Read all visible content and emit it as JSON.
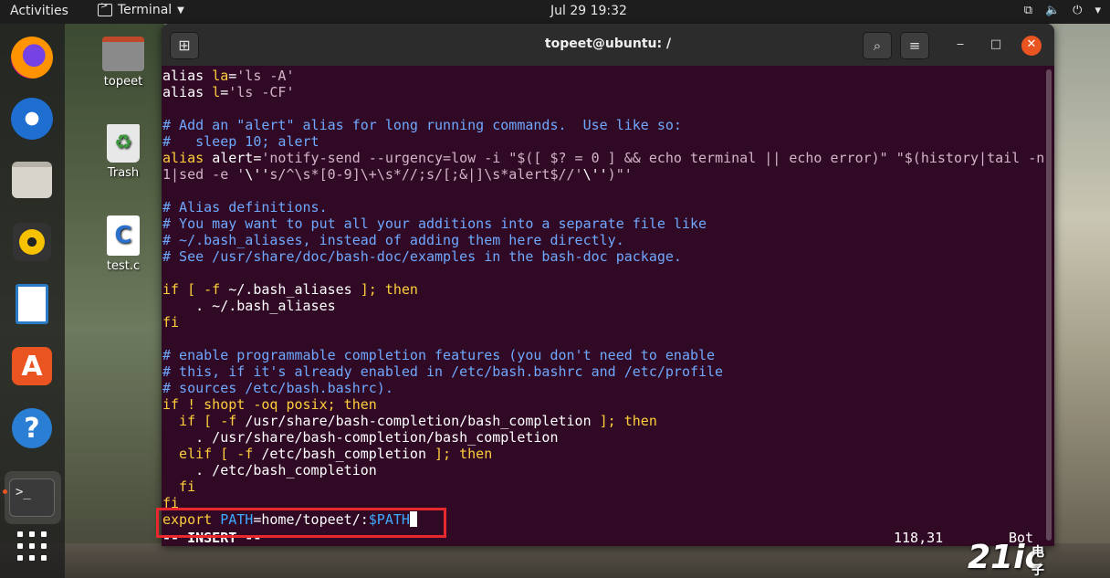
{
  "topbar": {
    "activities": "Activities",
    "app_name": "Terminal",
    "clock": "Jul 29  19:32",
    "tray_icons": [
      "network-icon",
      "volume-icon",
      "power-icon",
      "chevron-down-icon"
    ]
  },
  "dock": {
    "items": [
      "firefox-icon",
      "thunderbird-icon",
      "files-icon",
      "rhythmbox-icon",
      "libreoffice-writer-icon",
      "software-store-icon",
      "help-icon",
      "terminal-icon",
      "show-apps-icon"
    ]
  },
  "desktop": {
    "home_label": "topeet",
    "trash_label": "Trash",
    "file_label": "test.c",
    "file_glyph": "C"
  },
  "window": {
    "title": "topeet@ubuntu: /",
    "controls": {
      "minimize": "‒",
      "maximize": "□",
      "close": "✕"
    }
  },
  "terminal": {
    "lines": [
      [
        [
          "id",
          "alias "
        ],
        [
          "kw",
          "la"
        ],
        [
          "id",
          "="
        ],
        [
          "str",
          "'ls -A'"
        ]
      ],
      [
        [
          "id",
          "alias "
        ],
        [
          "kw",
          "l"
        ],
        [
          "id",
          "="
        ],
        [
          "str",
          "'ls -CF'"
        ]
      ],
      [],
      [
        [
          "cm",
          "# Add an \"alert\" alias for long running commands.  Use like so:"
        ]
      ],
      [
        [
          "cm",
          "#   sleep 10; alert"
        ]
      ],
      [
        [
          "kw",
          "alias "
        ],
        [
          "id",
          "alert"
        ],
        [
          "id",
          "="
        ],
        [
          "str",
          "'notify-send --urgency=low -i \"$([ $? = 0 ] && echo terminal || echo error)\" \"$(history|tail -n"
        ]
      ],
      [
        [
          "str",
          "1|sed -e '"
        ],
        [
          "id",
          "\\''"
        ],
        [
          "str",
          "s/^\\s*[0-9]\\+\\s*//;s/[;&|]\\s*alert$//'"
        ],
        [
          "id",
          "\\''"
        ],
        [
          "str",
          ")\"'"
        ]
      ],
      [],
      [
        [
          "cm",
          "# Alias definitions."
        ]
      ],
      [
        [
          "cm",
          "# You may want to put all your additions into a separate file like"
        ]
      ],
      [
        [
          "cm",
          "# ~/.bash_aliases, instead of adding them here directly."
        ]
      ],
      [
        [
          "cm",
          "# See /usr/share/doc/bash-doc/examples in the bash-doc package."
        ]
      ],
      [],
      [
        [
          "kw",
          "if [ -f "
        ],
        [
          "id",
          "~/.bash_aliases"
        ],
        [
          "kw",
          " ]; then"
        ]
      ],
      [
        [
          "id",
          "    . ~/.bash_aliases"
        ]
      ],
      [
        [
          "kw",
          "fi"
        ]
      ],
      [],
      [
        [
          "cm",
          "# enable programmable completion features (you don't need to enable"
        ]
      ],
      [
        [
          "cm",
          "# this, if it's already enabled in /etc/bash.bashrc and /etc/profile"
        ]
      ],
      [
        [
          "cm",
          "# sources /etc/bash.bashrc)."
        ]
      ],
      [
        [
          "kw",
          "if ! shopt -oq posix; then"
        ]
      ],
      [
        [
          "kw",
          "  if [ -f "
        ],
        [
          "id",
          "/usr/share/bash-completion/bash_completion"
        ],
        [
          "kw",
          " ]; then"
        ]
      ],
      [
        [
          "id",
          "    . /usr/share/bash-completion/bash_completion"
        ]
      ],
      [
        [
          "kw",
          "  elif [ -f "
        ],
        [
          "id",
          "/etc/bash_completion"
        ],
        [
          "kw",
          " ]; then"
        ]
      ],
      [
        [
          "id",
          "    . /etc/bash_completion"
        ]
      ],
      [
        [
          "kw",
          "  fi"
        ]
      ],
      [
        [
          "kw",
          "fi"
        ]
      ],
      [
        [
          "kw",
          "export "
        ],
        [
          "var",
          "PATH"
        ],
        [
          "id",
          "=home/topeet/:"
        ],
        [
          "var",
          "$PATH"
        ]
      ]
    ],
    "status_mode": "-- INSERT --",
    "status_position": "118,31",
    "status_scroll": "Bot"
  },
  "watermark": {
    "brand": "21ic",
    "sub": "电子网"
  }
}
